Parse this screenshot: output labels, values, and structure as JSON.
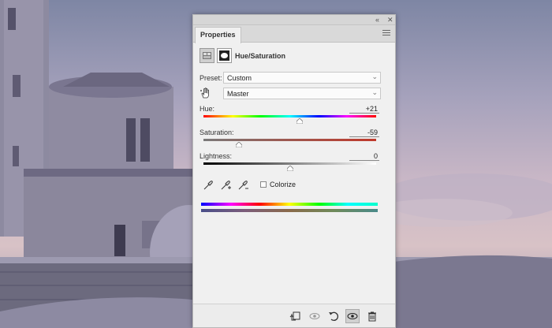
{
  "panel": {
    "tab_label": "Properties",
    "adjustment_title": "Hue/Saturation",
    "preset_label": "Preset:",
    "preset_value": "Custom",
    "channel_value": "Master",
    "hue": {
      "label": "Hue:",
      "value": "+21",
      "level": 0.558
    },
    "saturation": {
      "label": "Saturation:",
      "value": "-59",
      "level": 0.205
    },
    "lightness": {
      "label": "Lightness:",
      "value": "0",
      "level": 0.5
    },
    "colorize_label": "Colorize",
    "colorize_checked": false
  },
  "icons": {
    "collapse": "double-chevron-icon",
    "close": "close-icon",
    "panel_menu": "hamburger-menu-icon",
    "adjustment": "hue-saturation-icon",
    "mask": "layer-mask-icon",
    "targeted_adjustment": "hand-icon",
    "eyedropper": "eyedropper-icon",
    "eyedropper_add": "eyedropper-plus-icon",
    "eyedropper_subtract": "eyedropper-minus-icon",
    "clip": "clip-to-layer-icon",
    "view_previous": "view-previous-state-icon",
    "reset": "reset-icon",
    "visibility": "eye-icon",
    "delete": "trash-icon"
  },
  "colors": {
    "panel_bg": "#f0f0f0",
    "hue_track_start": "#ff0000",
    "saturation_end": "#c0392b"
  }
}
